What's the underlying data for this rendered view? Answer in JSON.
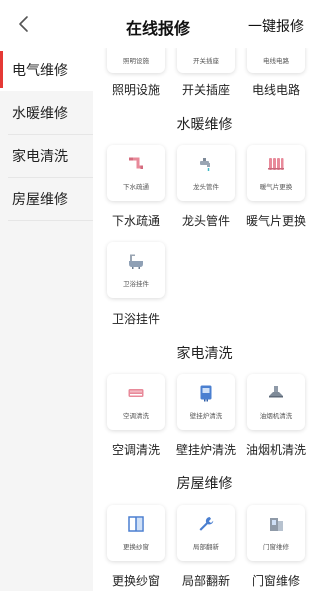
{
  "header": {
    "title": "在线报修",
    "action_label": "一键报修"
  },
  "sidebar": {
    "items": [
      {
        "label": "电气维修",
        "active": true
      },
      {
        "label": "水暖维修",
        "active": false
      },
      {
        "label": "家电清洗",
        "active": false
      },
      {
        "label": "房屋维修",
        "active": false
      }
    ]
  },
  "content": {
    "electrical": {
      "items": [
        {
          "mini": "照明设施",
          "label": "照明设施"
        },
        {
          "mini": "开关插座",
          "label": "开关插座"
        },
        {
          "mini": "电线电路",
          "label": "电线电路"
        }
      ]
    },
    "plumbing": {
      "title": "水暖维修",
      "items": [
        {
          "mini": "下水疏通",
          "label": "下水疏通",
          "icon": "drain-pipe-icon"
        },
        {
          "mini": "龙头管件",
          "label": "龙头管件",
          "icon": "faucet-icon"
        },
        {
          "mini": "暖气片更换",
          "label": "暖气片更换",
          "icon": "radiator-icon"
        },
        {
          "mini": "卫浴挂件",
          "label": "卫浴挂件",
          "icon": "bathtub-icon"
        }
      ]
    },
    "appliance": {
      "title": "家电清洗",
      "items": [
        {
          "mini": "空调清洗",
          "label": "空调清洗",
          "icon": "air-conditioner-icon"
        },
        {
          "mini": "壁挂炉清洗",
          "label": "壁挂炉清洗",
          "icon": "wall-boiler-icon"
        },
        {
          "mini": "油烟机清洗",
          "label": "油烟机清洗",
          "icon": "range-hood-icon"
        }
      ]
    },
    "house": {
      "title": "房屋维修",
      "items": [
        {
          "mini": "更换纱窗",
          "label": "更换纱窗",
          "icon": "window-screen-icon"
        },
        {
          "mini": "局部翻新",
          "label": "局部翻新",
          "icon": "wrench-icon"
        },
        {
          "mini": "门窗维修",
          "label": "门窗维修",
          "icon": "door-window-icon"
        }
      ]
    }
  },
  "colors": {
    "accent": "#e53935",
    "icon_pink": "#e88a9a",
    "icon_blue": "#4a7fd0",
    "icon_teal": "#3fb8c6"
  }
}
